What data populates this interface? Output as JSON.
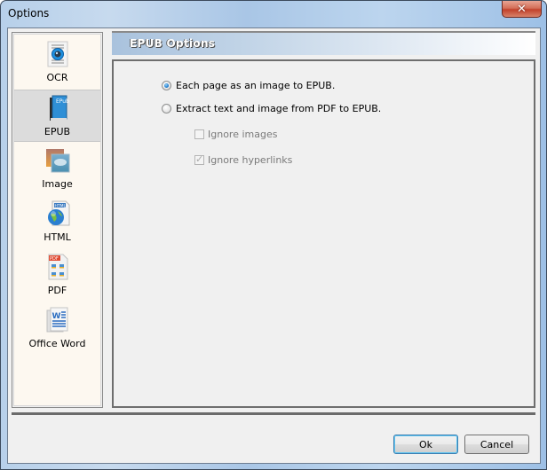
{
  "window": {
    "title": "Options",
    "close_glyph": "✕"
  },
  "sidebar": {
    "selected": "EPUB",
    "items": [
      {
        "label": "OCR",
        "icon": "ocr-document-icon",
        "active": false
      },
      {
        "label": "EPUB",
        "icon": "epub-book-icon",
        "active": true
      },
      {
        "label": "Image",
        "icon": "image-picture-icon",
        "active": false
      },
      {
        "label": "HTML",
        "icon": "html-globe-icon",
        "active": false
      },
      {
        "label": "PDF",
        "icon": "pdf-document-icon",
        "active": false
      },
      {
        "label": "Office Word",
        "icon": "word-document-icon",
        "active": false
      }
    ]
  },
  "panel": {
    "title": "EPUB Options",
    "radios": [
      {
        "label": "Each page as an image to EPUB.",
        "checked": true
      },
      {
        "label": "Extract text and image from PDF to EPUB.",
        "checked": false
      }
    ],
    "checkboxes": [
      {
        "label": "Ignore images",
        "checked": false,
        "enabled": false
      },
      {
        "label": "Ignore hyperlinks",
        "checked": true,
        "enabled": false
      }
    ]
  },
  "buttons": {
    "ok": "Ok",
    "cancel": "Cancel"
  },
  "colors": {
    "radio_accent": "#1f7ed1",
    "close_button": "#c2412b",
    "sidebar_bg": "#fdf8f0",
    "selected_item_bg": "#dcdcdc"
  }
}
